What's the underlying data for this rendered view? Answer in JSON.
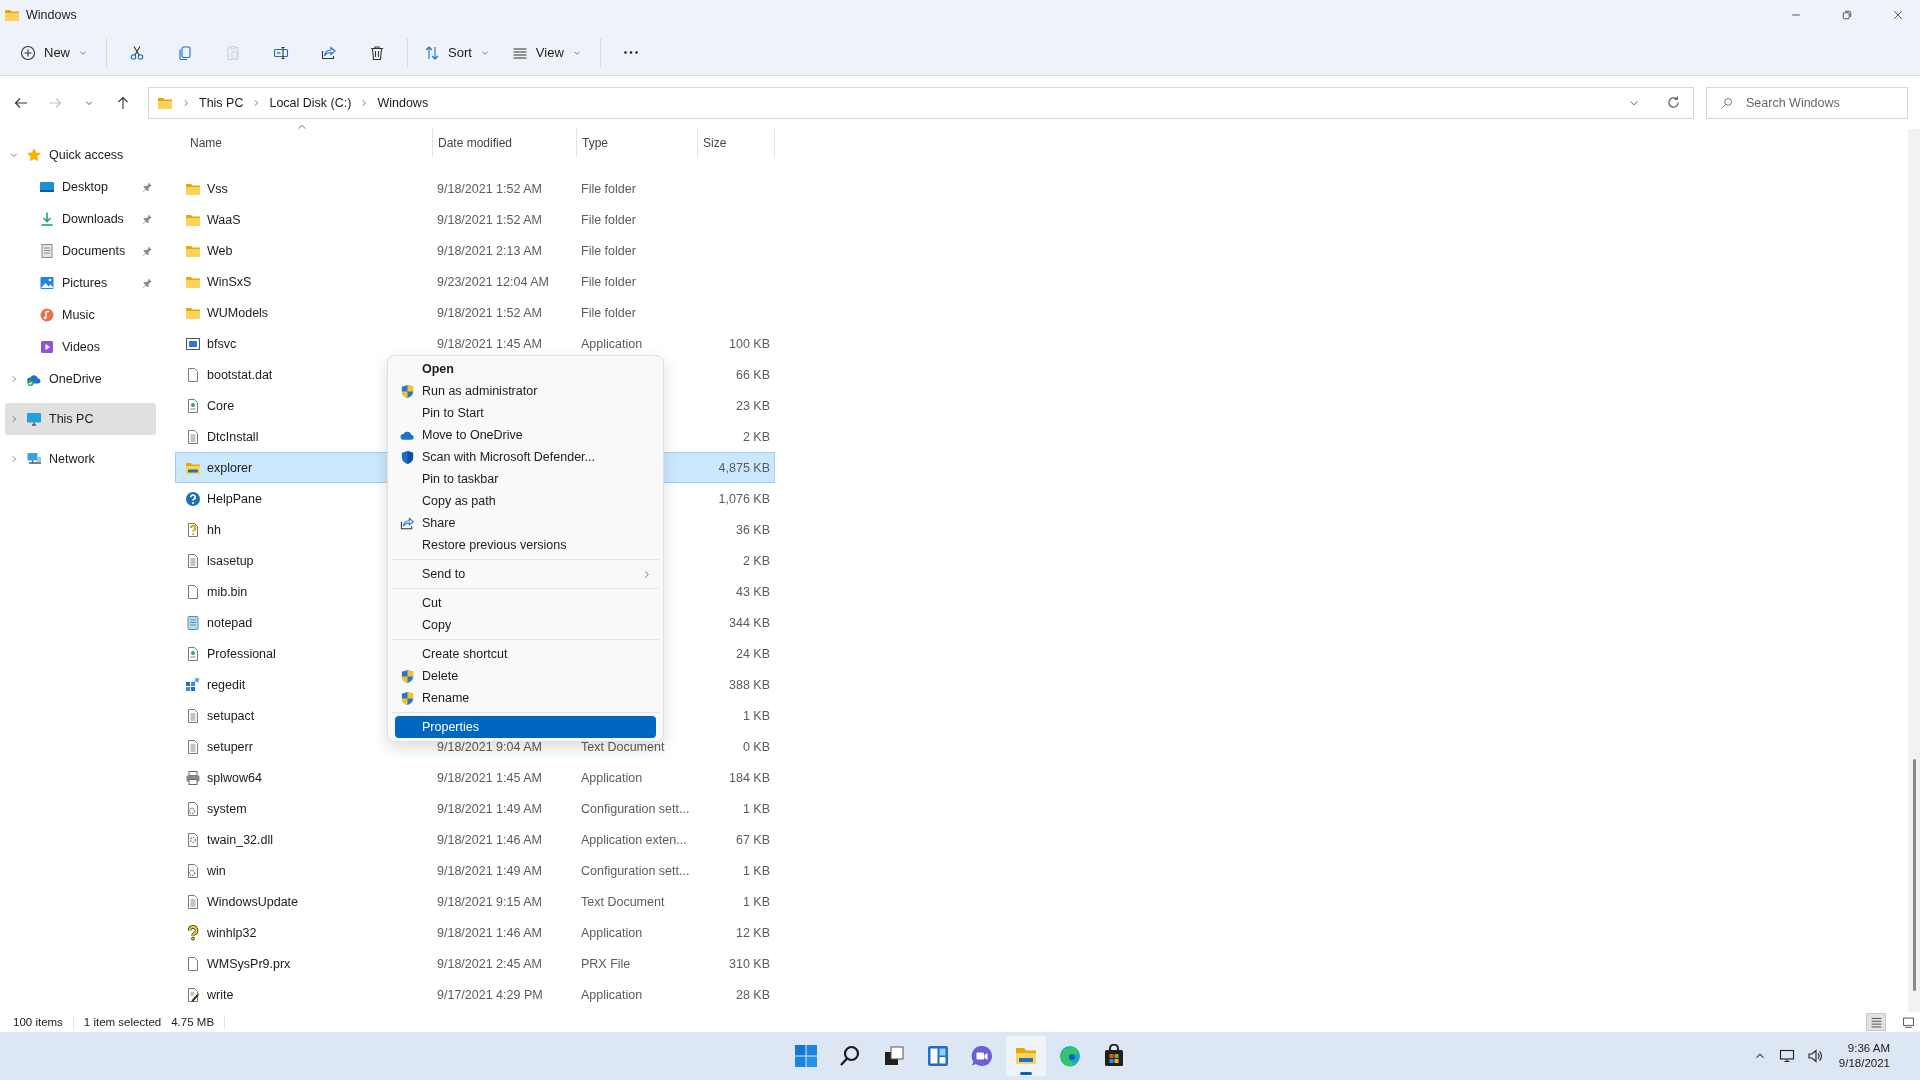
{
  "window": {
    "title": "Windows"
  },
  "toolbar": {
    "items": [
      {
        "kind": "new",
        "label": "New",
        "disabled": false
      },
      {
        "kind": "cut",
        "disabled": false
      },
      {
        "kind": "copy",
        "disabled": false
      },
      {
        "kind": "paste",
        "disabled": true
      },
      {
        "kind": "rename",
        "disabled": false
      },
      {
        "kind": "share",
        "disabled": false
      },
      {
        "kind": "delete",
        "disabled": false
      },
      {
        "kind": "sort",
        "label": "Sort",
        "disabled": false
      },
      {
        "kind": "view",
        "label": "View",
        "disabled": false
      },
      {
        "kind": "more",
        "disabled": false
      }
    ]
  },
  "navigation": [
    {
      "kind": "back",
      "disabled": false
    },
    {
      "kind": "forward",
      "disabled": true
    },
    {
      "kind": "recent",
      "disabled": false
    },
    {
      "kind": "up",
      "disabled": false
    }
  ],
  "address_bar": {
    "path": [
      "This PC",
      "Local Disk (C:)",
      "Windows"
    ]
  },
  "search": {
    "placeholder": "Search Windows"
  },
  "sidebar": {
    "items": [
      {
        "label": "Quick access",
        "kind": "star",
        "expanded": true,
        "selected": false,
        "children": [
          {
            "label": "Desktop",
            "kind": "desktop",
            "pinned": true,
            "selected": false
          },
          {
            "label": "Downloads",
            "kind": "downloads",
            "pinned": true,
            "selected": false
          },
          {
            "label": "Documents",
            "kind": "documents",
            "pinned": true,
            "selected": false
          },
          {
            "label": "Pictures",
            "kind": "pictures",
            "pinned": true,
            "selected": false
          },
          {
            "label": "Music",
            "kind": "music",
            "pinned": false,
            "selected": false
          },
          {
            "label": "Videos",
            "kind": "videos",
            "pinned": false,
            "selected": false
          }
        ]
      },
      {
        "label": "OneDrive",
        "kind": "onedrive",
        "expanded": false,
        "selected": false
      },
      {
        "label": "This PC",
        "kind": "pc",
        "expanded": false,
        "selected": true
      },
      {
        "label": "Network",
        "kind": "network",
        "expanded": false,
        "selected": false
      }
    ]
  },
  "table": {
    "columns": [
      {
        "label": "Name",
        "sorted": true
      },
      {
        "label": "Date modified",
        "sorted": false
      },
      {
        "label": "Type",
        "sorted": false
      },
      {
        "label": "Size",
        "sorted": false
      }
    ],
    "rows": [
      {
        "name": "Vss",
        "date": "9/18/2021 1:52 AM",
        "type": "File folder",
        "kind": "folder",
        "selected": false
      },
      {
        "name": "WaaS",
        "date": "9/18/2021 1:52 AM",
        "type": "File folder",
        "kind": "folder",
        "selected": false
      },
      {
        "name": "Web",
        "date": "9/18/2021 2:13 AM",
        "type": "File folder",
        "kind": "folder",
        "selected": false
      },
      {
        "name": "WinSxS",
        "date": "9/23/2021 12:04 AM",
        "type": "File folder",
        "kind": "folder",
        "selected": false
      },
      {
        "name": "WUModels",
        "date": "9/18/2021 1:52 AM",
        "type": "File folder",
        "kind": "folder",
        "selected": false
      },
      {
        "name": "bfsvc",
        "date": "9/18/2021 1:45 AM",
        "type": "Application",
        "size": "100 KB",
        "kind": "app",
        "selected": false
      },
      {
        "name": "bootstat.dat",
        "size": "66 KB",
        "kind": "file",
        "selected": false
      },
      {
        "name": "Core",
        "size": "23 KB",
        "kind": "sysdoc",
        "selected": false
      },
      {
        "name": "DtcInstall",
        "size": "2 KB",
        "kind": "text",
        "selected": false
      },
      {
        "name": "explorer",
        "size": "4,875 KB",
        "kind": "explorer",
        "selected": true
      },
      {
        "name": "HelpPane",
        "size": "1,076 KB",
        "kind": "help",
        "selected": false
      },
      {
        "name": "hh",
        "size": "36 KB",
        "kind": "helpdoc",
        "selected": false
      },
      {
        "name": "lsasetup",
        "size": "2 KB",
        "kind": "text",
        "selected": false
      },
      {
        "name": "mib.bin",
        "size": "43 KB",
        "kind": "file",
        "selected": false
      },
      {
        "name": "notepad",
        "size": "344 KB",
        "kind": "notepad",
        "selected": false
      },
      {
        "name": "Professional",
        "size": "24 KB",
        "kind": "sysdoc",
        "selected": false
      },
      {
        "name": "regedit",
        "size": "388 KB",
        "kind": "registry",
        "selected": false
      },
      {
        "name": "setupact",
        "size": "1 KB",
        "kind": "text",
        "selected": false
      },
      {
        "name": "setuperr",
        "date": "9/18/2021 9:04 AM",
        "type": "Text Document",
        "size": "0 KB",
        "kind": "text",
        "selected": false
      },
      {
        "name": "splwow64",
        "date": "9/18/2021 1:45 AM",
        "type": "Application",
        "size": "184 KB",
        "kind": "printer",
        "selected": false
      },
      {
        "name": "system",
        "date": "9/18/2021 1:49 AM",
        "type": "Configuration sett...",
        "size": "1 KB",
        "kind": "config",
        "selected": false
      },
      {
        "name": "twain_32.dll",
        "date": "9/18/2021 1:46 AM",
        "type": "Application exten...",
        "size": "67 KB",
        "kind": "dll",
        "selected": false
      },
      {
        "name": "win",
        "date": "9/18/2021 1:49 AM",
        "type": "Configuration sett...",
        "size": "1 KB",
        "kind": "config",
        "selected": false
      },
      {
        "name": "WindowsUpdate",
        "date": "9/18/2021 9:15 AM",
        "type": "Text Document",
        "size": "1 KB",
        "kind": "text",
        "selected": false
      },
      {
        "name": "winhlp32",
        "date": "9/18/2021 1:46 AM",
        "type": "Application",
        "size": "12 KB",
        "kind": "question",
        "selected": false
      },
      {
        "name": "WMSysPr9.prx",
        "date": "9/18/2021 2:45 AM",
        "type": "PRX File",
        "size": "310 KB",
        "kind": "file",
        "selected": false
      },
      {
        "name": "write",
        "date": "9/17/2021 4:29 PM",
        "type": "Application",
        "size": "28 KB",
        "kind": "write",
        "selected": false
      }
    ]
  },
  "context_menu": {
    "groups": [
      [
        {
          "label": "Open",
          "kind": "plain",
          "default": true,
          "selected": false
        },
        {
          "label": "Run as administrator",
          "kind": "uac",
          "default": false,
          "selected": false
        },
        {
          "label": "Pin to Start",
          "kind": "plain",
          "default": false,
          "selected": false
        },
        {
          "label": "Move to OneDrive",
          "kind": "cloud",
          "default": false,
          "selected": false
        },
        {
          "label": "Scan with Microsoft Defender...",
          "kind": "defender",
          "default": false,
          "selected": false
        },
        {
          "label": "Pin to taskbar",
          "kind": "plain",
          "default": false,
          "selected": false
        },
        {
          "label": "Copy as path",
          "kind": "plain",
          "default": false,
          "selected": false
        },
        {
          "label": "Share",
          "kind": "share",
          "default": false,
          "selected": false
        },
        {
          "label": "Restore previous versions",
          "kind": "plain",
          "default": false,
          "selected": false
        }
      ],
      [
        {
          "label": "Send to",
          "kind": "plain",
          "default": false,
          "selected": false,
          "submenu": true
        }
      ],
      [
        {
          "label": "Cut",
          "kind": "plain",
          "default": false,
          "selected": false
        },
        {
          "label": "Copy",
          "kind": "plain",
          "default": false,
          "selected": false
        }
      ],
      [
        {
          "label": "Create shortcut",
          "kind": "plain",
          "default": false,
          "selected": false
        },
        {
          "label": "Delete",
          "kind": "uac",
          "default": false,
          "selected": false
        },
        {
          "label": "Rename",
          "kind": "uac",
          "default": false,
          "selected": false
        }
      ],
      [
        {
          "label": "Properties",
          "kind": "plain",
          "default": false,
          "selected": true
        }
      ]
    ]
  },
  "status_bar": {
    "item_count": "100 items",
    "selection": "1 item selected",
    "selection_size": "4.75 MB",
    "views": [
      {
        "kind": "details",
        "selected": true
      },
      {
        "kind": "tiles",
        "selected": false
      }
    ]
  },
  "taskbar": {
    "apps": [
      {
        "kind": "start",
        "active": false
      },
      {
        "kind": "search",
        "active": false
      },
      {
        "kind": "taskview",
        "active": false
      },
      {
        "kind": "widgets",
        "active": false
      },
      {
        "kind": "chat",
        "active": false
      },
      {
        "kind": "explorer",
        "active": true
      },
      {
        "kind": "edge",
        "active": false
      },
      {
        "kind": "store",
        "active": false
      }
    ],
    "time": "9:36 AM",
    "date": "9/18/2021"
  }
}
